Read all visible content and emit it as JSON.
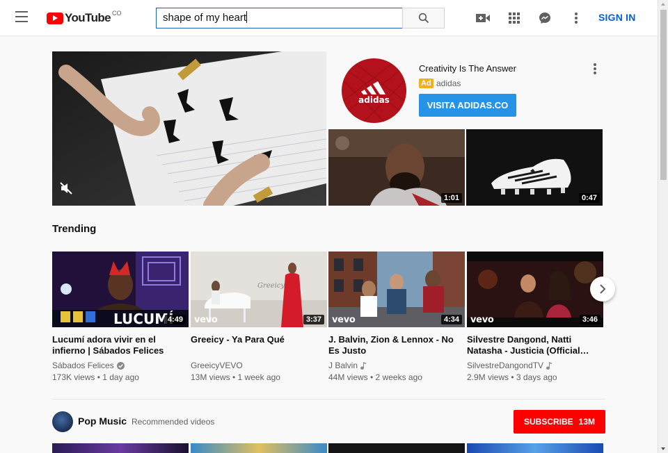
{
  "header": {
    "logo_text": "YouTube",
    "country_code": "CO",
    "search_value": "shape of my heart",
    "sign_in_label": "SIGN IN"
  },
  "ad": {
    "title": "Creativity Is The Answer",
    "badge": "Ad",
    "advertiser": "adidas",
    "cta_label": "VISITA ADIDAS.CO",
    "logo_text": "adidas",
    "thumbs": [
      {
        "duration": "1:01"
      },
      {
        "duration": "0:47"
      }
    ]
  },
  "trending": {
    "title": "Trending",
    "videos": [
      {
        "title": "Lucumí adora vivir en el infierno | Sábados Felices",
        "channel": "Sábados Felices",
        "verified": true,
        "music": false,
        "meta": "173K views • 1 day ago",
        "duration": "4:49",
        "overlay": "LUCUMÍ"
      },
      {
        "title": "Greeicy - Ya Para Qué",
        "channel": "GreeicyVEVO",
        "verified": false,
        "music": false,
        "meta": "13M views • 1 week ago",
        "duration": "3:37",
        "overlay": "vevo"
      },
      {
        "title": "J. Balvin, Zion & Lennox - No Es Justo",
        "channel": "J Balvin",
        "verified": false,
        "music": true,
        "meta": "44M views • 2 weeks ago",
        "duration": "4:34",
        "overlay": "vevo"
      },
      {
        "title": "Silvestre Dangond, Natti Natasha - Justicia (Official…",
        "channel": "SilvestreDangondTV",
        "verified": false,
        "music": true,
        "meta": "2.9M views • 3 days ago",
        "duration": "3:46",
        "overlay": "vevo"
      }
    ]
  },
  "pop": {
    "title": "Pop Music",
    "subtitle": "Recommended videos",
    "subscribe_label": "SUBSCRIBE",
    "subscriber_count": "13M"
  },
  "colors": {
    "brand_red": "#ff0000",
    "link_blue": "#065fd4",
    "cta_blue": "#2793e6",
    "ad_yellow": "#f2b01e"
  }
}
